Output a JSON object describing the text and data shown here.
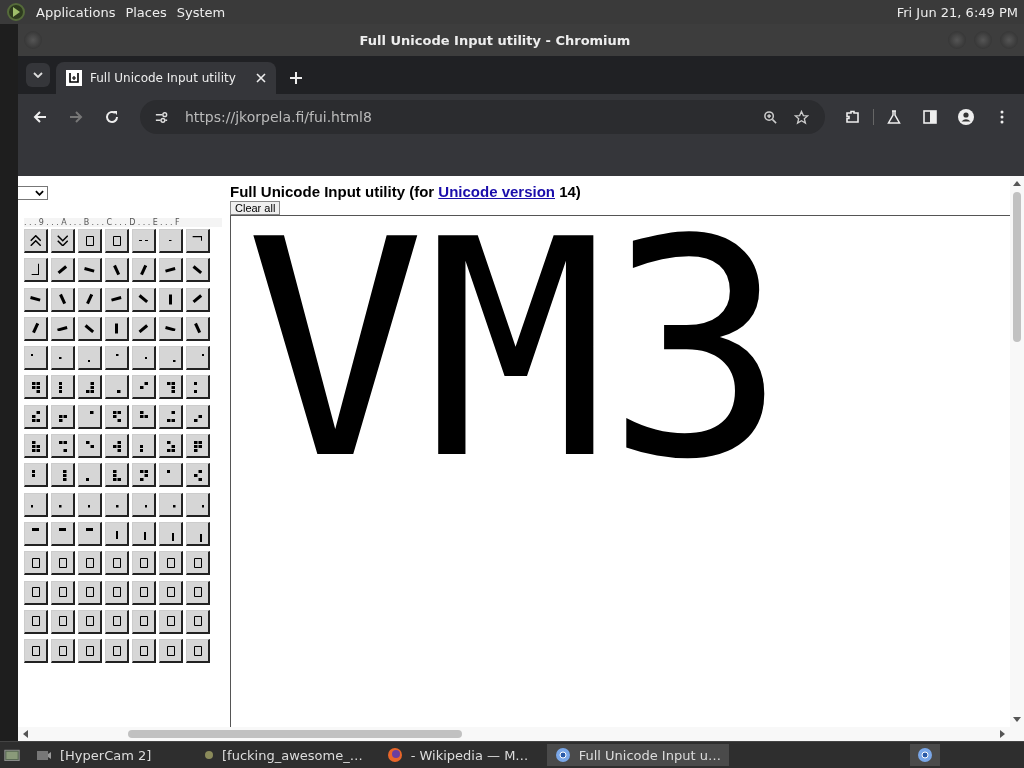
{
  "top_panel": {
    "menus": [
      "Applications",
      "Places",
      "System"
    ],
    "clock": "Fri Jun 21, 6:49 PM"
  },
  "window": {
    "title": "Full Unicode Input utility - Chromium"
  },
  "tabs": [
    {
      "label": "Full Unicode Input utility",
      "selected": true
    }
  ],
  "toolbar": {
    "url": "https://jkorpela.fi/fui.html8",
    "forward_disabled": true
  },
  "page": {
    "heading": "Full Unicode Input utility (for ",
    "heading_link": "Unicode version",
    "heading_end": " 14)",
    "clear_button": "Clear all",
    "text_value": "VM3",
    "grid": {
      "header": "...9...A...B...C...D...E...F",
      "rows": [
        [
          {
            "kind": "double-up"
          },
          {
            "kind": "double-down"
          },
          {
            "kind": "missing"
          },
          {
            "kind": "missing"
          },
          {
            "kind": "dashes"
          },
          {
            "kind": "dash"
          },
          {
            "kind": "corner"
          }
        ],
        [
          {
            "kind": "corner"
          },
          {
            "kind": "stroke"
          },
          {
            "kind": "stroke"
          },
          {
            "kind": "stroke"
          },
          {
            "kind": "stroke"
          },
          {
            "kind": "stroke"
          },
          {
            "kind": "stroke"
          }
        ],
        [
          {
            "kind": "stroke"
          },
          {
            "kind": "stroke"
          },
          {
            "kind": "stroke"
          },
          {
            "kind": "stroke"
          },
          {
            "kind": "stroke"
          },
          {
            "kind": "stroke"
          },
          {
            "kind": "stroke"
          }
        ],
        [
          {
            "kind": "stroke"
          },
          {
            "kind": "stroke"
          },
          {
            "kind": "stroke"
          },
          {
            "kind": "stroke"
          },
          {
            "kind": "stroke"
          },
          {
            "kind": "stroke"
          },
          {
            "kind": "stroke"
          }
        ],
        [
          {
            "kind": "dot"
          },
          {
            "kind": "dot"
          },
          {
            "kind": "dot"
          },
          {
            "kind": "dot"
          },
          {
            "kind": "dot"
          },
          {
            "kind": "dot"
          },
          {
            "kind": "dot"
          }
        ],
        [
          {
            "kind": "blocks"
          },
          {
            "kind": "blocks"
          },
          {
            "kind": "blocks"
          },
          {
            "kind": "blocks"
          },
          {
            "kind": "blocks"
          },
          {
            "kind": "blocks"
          },
          {
            "kind": "blocks"
          }
        ],
        [
          {
            "kind": "blocks"
          },
          {
            "kind": "blocks"
          },
          {
            "kind": "blocks"
          },
          {
            "kind": "blocks"
          },
          {
            "kind": "blocks"
          },
          {
            "kind": "blocks"
          },
          {
            "kind": "blocks"
          }
        ],
        [
          {
            "kind": "blocks"
          },
          {
            "kind": "blocks"
          },
          {
            "kind": "blocks"
          },
          {
            "kind": "blocks"
          },
          {
            "kind": "blocks"
          },
          {
            "kind": "blocks"
          },
          {
            "kind": "blocks"
          }
        ],
        [
          {
            "kind": "blocks"
          },
          {
            "kind": "blocks"
          },
          {
            "kind": "blocks"
          },
          {
            "kind": "blocks"
          },
          {
            "kind": "blocks"
          },
          {
            "kind": "blocks"
          },
          {
            "kind": "blocks"
          }
        ],
        [
          {
            "kind": "dot"
          },
          {
            "kind": "dot"
          },
          {
            "kind": "dot"
          },
          {
            "kind": "dot"
          },
          {
            "kind": "dot"
          },
          {
            "kind": "dot"
          },
          {
            "kind": "dot"
          }
        ],
        [
          {
            "kind": "bar"
          },
          {
            "kind": "bar"
          },
          {
            "kind": "bar"
          },
          {
            "kind": "bar"
          },
          {
            "kind": "bar"
          },
          {
            "kind": "bar"
          },
          {
            "kind": "bar"
          }
        ],
        [
          {
            "kind": "missing"
          },
          {
            "kind": "missing"
          },
          {
            "kind": "missing"
          },
          {
            "kind": "missing"
          },
          {
            "kind": "missing"
          },
          {
            "kind": "missing"
          },
          {
            "kind": "missing"
          }
        ],
        [
          {
            "kind": "missing"
          },
          {
            "kind": "missing"
          },
          {
            "kind": "missing"
          },
          {
            "kind": "missing"
          },
          {
            "kind": "missing"
          },
          {
            "kind": "missing"
          },
          {
            "kind": "missing"
          }
        ],
        [
          {
            "kind": "missing"
          },
          {
            "kind": "missing"
          },
          {
            "kind": "missing"
          },
          {
            "kind": "missing"
          },
          {
            "kind": "missing"
          },
          {
            "kind": "missing"
          },
          {
            "kind": "missing"
          }
        ],
        [
          {
            "kind": "missing"
          },
          {
            "kind": "missing"
          },
          {
            "kind": "missing"
          },
          {
            "kind": "missing"
          },
          {
            "kind": "missing"
          },
          {
            "kind": "missing"
          },
          {
            "kind": "missing"
          }
        ]
      ]
    }
  },
  "taskbar": [
    {
      "label": "[HyperCam 2]",
      "kind": "camera",
      "selected": false
    },
    {
      "label": "[fucking_awesome_…",
      "kind": "dot",
      "selected": false
    },
    {
      "label": "- Wikipedia — M…",
      "kind": "firefox",
      "selected": false
    },
    {
      "label": "Full Unicode Input u…",
      "kind": "chromium",
      "selected": true
    }
  ]
}
